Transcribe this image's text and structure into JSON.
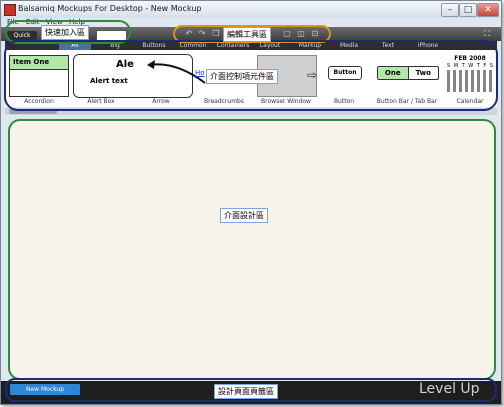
{
  "window": {
    "title": "Balsamiq Mockups For Desktop - New Mockup",
    "controls": [
      "–",
      "□",
      "✕"
    ]
  },
  "menu": [
    "File",
    "Edit",
    "View",
    "Help"
  ],
  "toolbar": {
    "quick_add_label": "Quick Add:",
    "quick_add_value": "",
    "icons": [
      "undo-icon",
      "redo-icon",
      "copy-icon",
      "paste-icon",
      "group-icon",
      "ungroup-icon",
      "lock-icon"
    ],
    "fullscreen_icon": "fullscreen-icon"
  },
  "tabs": [
    {
      "label": "All",
      "active": true
    },
    {
      "label": "Big",
      "active": false
    },
    {
      "label": "Buttons",
      "active": false
    },
    {
      "label": "Common",
      "active": false
    },
    {
      "label": "Containers",
      "active": false
    },
    {
      "label": "Layout",
      "active": false
    },
    {
      "label": "Markup",
      "active": false
    },
    {
      "label": "Media",
      "active": false
    },
    {
      "label": "Text",
      "active": false
    },
    {
      "label": "iPhone",
      "active": false
    }
  ],
  "library": {
    "items": [
      "Accordion",
      "Alert Box",
      "Arrow",
      "Breadcrumbs",
      "Browser Window",
      "Button",
      "Button Bar / Tab Bar",
      "Calendar"
    ],
    "accordion_label": "Item One",
    "alert_title": "Ale",
    "alert_text": "Alert text",
    "breadcrumb_link": "Ho",
    "button_label": "Button",
    "buttonbar_labels": [
      "One",
      "Two"
    ],
    "calendar_header": "FEB 2008",
    "calendar_weekdays": [
      "S",
      "M",
      "T",
      "W",
      "T",
      "F",
      "S"
    ]
  },
  "bottom": {
    "new_mockup_label": "New Mockup",
    "watermark": "Level Up"
  },
  "annotations": {
    "quick_add": "快速加入區",
    "edit_toolbar": "編輯工具區",
    "ui_controls": "介面控制項元件區",
    "design_area": "介面設計區",
    "page_bar": "設計頁面頁籤區"
  },
  "colors": {
    "annotation_green": "#2f8a3e",
    "annotation_orange": "#e0901e",
    "annotation_navy": "#1b2a7a",
    "button_blue": "#2e86d6",
    "canvas_bg": "#f6f3e8"
  }
}
